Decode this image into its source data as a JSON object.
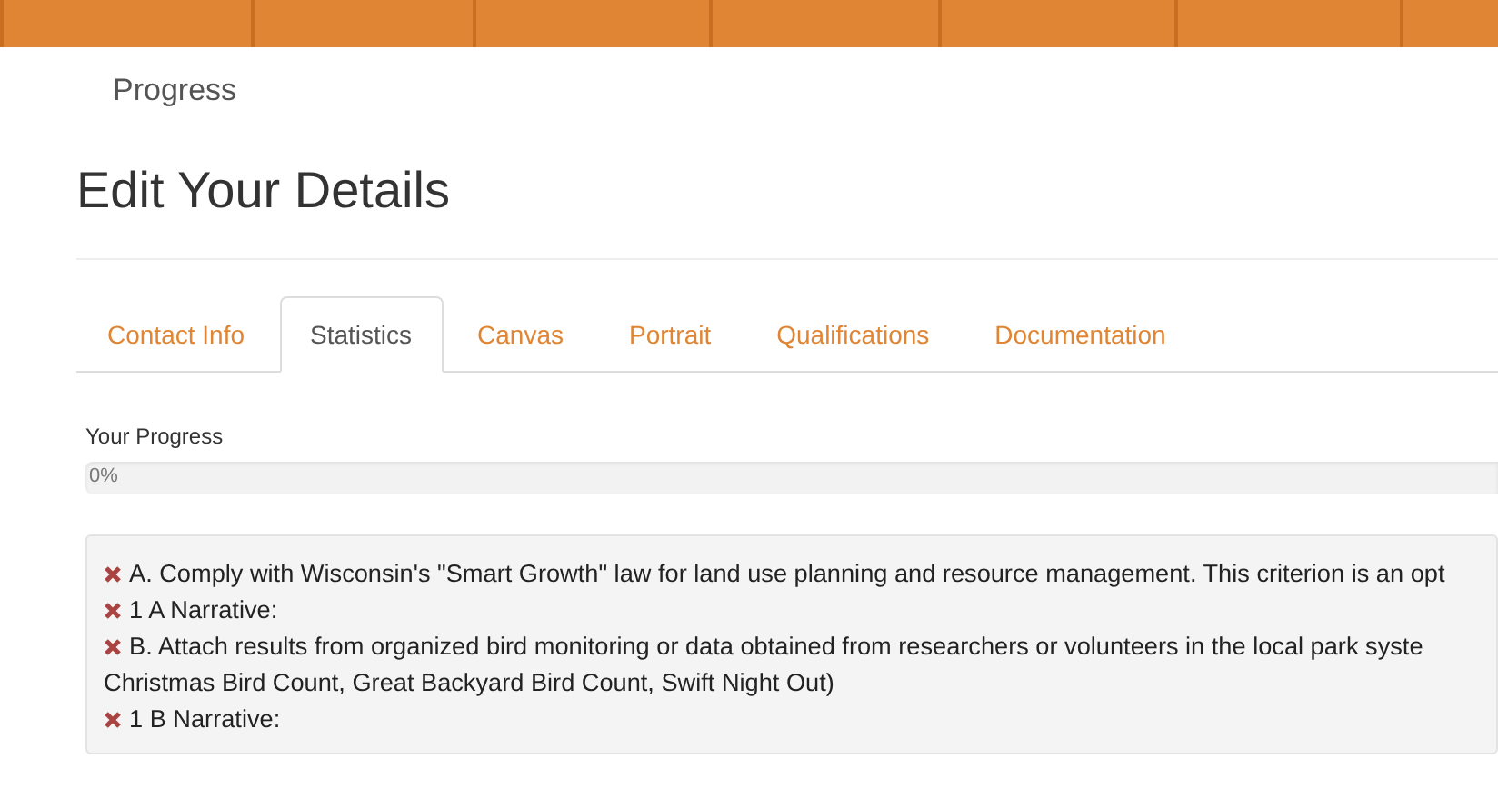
{
  "breadcrumb": "Progress",
  "title": "Edit Your Details",
  "tabs": [
    {
      "label": "Contact Info",
      "selected": false
    },
    {
      "label": "Statistics",
      "selected": true
    },
    {
      "label": "Canvas",
      "selected": false
    },
    {
      "label": "Portrait",
      "selected": false
    },
    {
      "label": "Qualifications",
      "selected": false
    },
    {
      "label": "Documentation",
      "selected": false
    }
  ],
  "progress": {
    "label": "Your Progress",
    "level": 0,
    "reading": "0%"
  },
  "criteria": [
    {
      "text": "A. Comply with Wisconsin's \"Smart Growth\" law for land use planning and resource management. This criterion is an opt",
      "done": false
    },
    {
      "text": "1 A Narrative:",
      "done": false
    },
    {
      "text": "B. Attach results from organized bird monitoring or data obtained from researchers or volunteers in the local park syste",
      "continuation": "Christmas Bird Count, Great Backyard Bird Count, Swift Night Out)",
      "done": false
    },
    {
      "text": "1 B Narrative:",
      "done": false
    }
  ]
}
